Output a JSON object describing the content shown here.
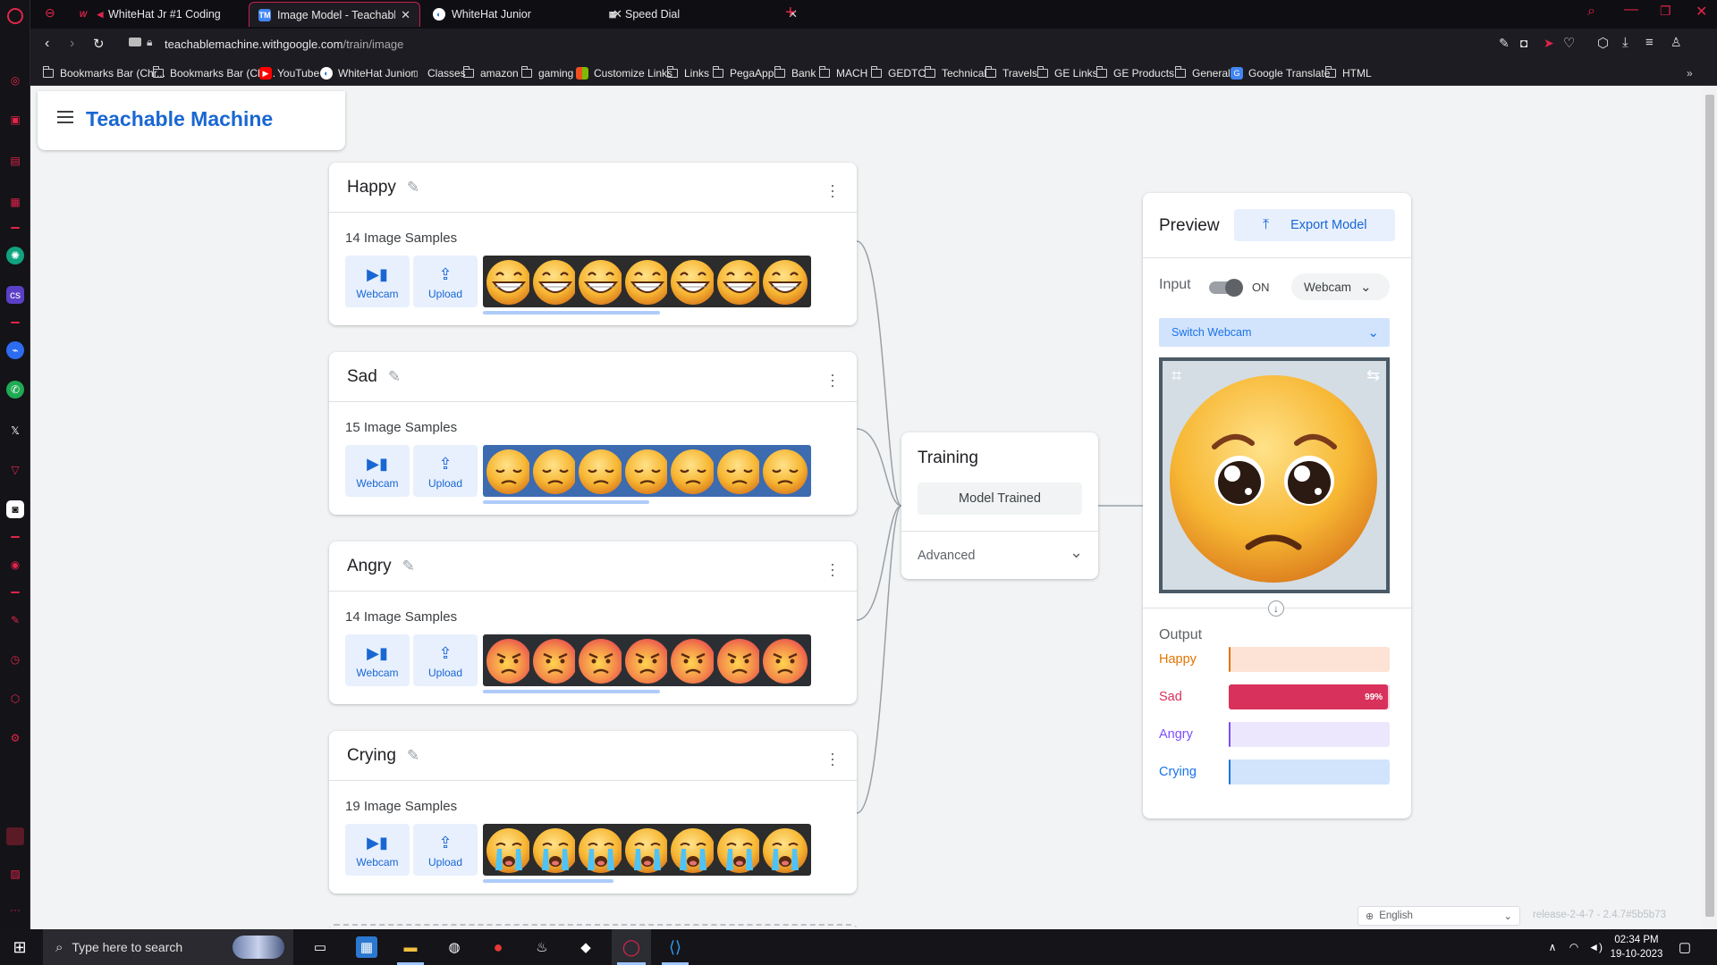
{
  "browser": {
    "tabs": [
      {
        "label": "WhiteHat Jr #1 Coding",
        "active": false
      },
      {
        "label": "Image Model - Teachable M",
        "active": true
      },
      {
        "label": "WhiteHat Junior",
        "active": false
      },
      {
        "label": "Speed Dial",
        "active": false
      }
    ],
    "url_host": "teachablemachine.withgoogle.com",
    "url_path": "/train/image",
    "bookmarks": [
      "Bookmarks Bar (Chr...",
      "Bookmarks Bar (Chr...",
      "YouTube",
      "WhiteHat Junior",
      "Classes",
      "amazon",
      "gaming",
      "Customize Links",
      "Links",
      "PegaApp",
      "Bank",
      "MACH",
      "GEDTC",
      "Technical",
      "Travels",
      "GE Links",
      "GE Products",
      "General",
      "Google Translate",
      "HTML"
    ],
    "accent_color": "#e0254a"
  },
  "app": {
    "title": "Teachable Machine",
    "brand_color": "#1967d2"
  },
  "classes": [
    {
      "name": "Happy",
      "samples": "14 Image Samples",
      "emoji": "happy"
    },
    {
      "name": "Sad",
      "samples": "15 Image Samples",
      "emoji": "sad"
    },
    {
      "name": "Angry",
      "samples": "14 Image Samples",
      "emoji": "angry"
    },
    {
      "name": "Crying",
      "samples": "19 Image Samples",
      "emoji": "crying"
    }
  ],
  "sample_buttons": {
    "webcam": "Webcam",
    "upload": "Upload"
  },
  "training": {
    "title": "Training",
    "button": "Model Trained",
    "advanced": "Advanced"
  },
  "preview": {
    "title": "Preview",
    "export_button": "Export Model",
    "input_label": "Input",
    "toggle_state": "ON",
    "source_select": "Webcam",
    "switch_webcam": "Switch Webcam",
    "output_title": "Output",
    "outputs": [
      {
        "label": "Happy",
        "value": 0.01,
        "text": "",
        "color": "#e37400",
        "bg": "#fde3d5"
      },
      {
        "label": "Sad",
        "value": 0.99,
        "text": "99%",
        "color": "#d8315b",
        "bg": "#fbd5de"
      },
      {
        "label": "Angry",
        "value": 0.0,
        "text": "",
        "color": "#7c4dff",
        "bg": "#ede7fd"
      },
      {
        "label": "Crying",
        "value": 0.0,
        "text": "",
        "color": "#1a73e8",
        "bg": "#d2e3fc"
      }
    ]
  },
  "footer": {
    "language": "English",
    "release": "release-2-4-7 - 2.4.7#5b5b73"
  },
  "taskbar": {
    "search_placeholder": "Type here to search",
    "time": "02:34 PM",
    "date": "19-10-2023"
  }
}
